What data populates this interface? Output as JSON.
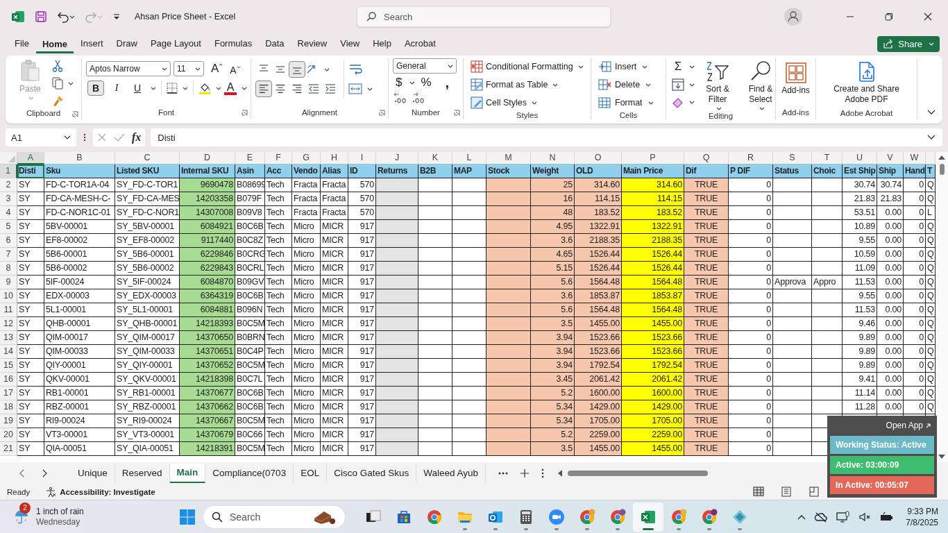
{
  "title_bar": {
    "title": "Ahsan Price Sheet  -  Excel",
    "search": {
      "placeholder": "Search"
    }
  },
  "menu": [
    {
      "label": "File",
      "selected": false
    },
    {
      "label": "Home",
      "selected": true
    },
    {
      "label": "Insert",
      "selected": false
    },
    {
      "label": "Draw",
      "selected": false
    },
    {
      "label": "Page Layout",
      "selected": false
    },
    {
      "label": "Formulas",
      "selected": false
    },
    {
      "label": "Data",
      "selected": false
    },
    {
      "label": "Review",
      "selected": false
    },
    {
      "label": "View",
      "selected": false
    },
    {
      "label": "Help",
      "selected": false
    },
    {
      "label": "Acrobat",
      "selected": false
    }
  ],
  "share": {
    "label": "Share"
  },
  "ribbon": {
    "clipboard": {
      "label": "Clipboard",
      "paste": {
        "label": "Paste",
        "disabled": true
      }
    },
    "font": {
      "label": "Font",
      "font_name": "Aptos Narrow",
      "font_size": "11",
      "grow": "A",
      "shrink": "A",
      "styles": [
        {
          "label": "B",
          "on": true
        },
        {
          "label": "I",
          "on": false
        },
        {
          "label": "U",
          "on": false
        }
      ],
      "font_color": "A"
    },
    "alignment": {
      "label": "Alignment",
      "vertical": [
        {
          "on": false
        },
        {
          "on": false
        },
        {
          "on": true
        }
      ],
      "horizontal": [
        {
          "on": true
        },
        {
          "on": false
        },
        {
          "on": false
        }
      ]
    },
    "number": {
      "label": "Number",
      "format": "General",
      "currency": "$",
      "percent": "%",
      "comma": ","
    },
    "styles": {
      "label": "Styles",
      "items": [
        "Conditional Formatting",
        "Format as Table",
        "Cell Styles"
      ]
    },
    "cells": {
      "label": "Cells",
      "items": [
        "Insert",
        "Delete",
        "Format"
      ]
    },
    "editing": {
      "label": "Editing",
      "sum": "Σ",
      "sort": "Sort & Filter",
      "find": "Find & Select"
    },
    "addins": {
      "label": "Add-ins",
      "button": "Add-ins"
    },
    "acrobat": {
      "label": "Adobe Acrobat",
      "button": "Create and Share Adobe PDF"
    }
  },
  "formula_bar": {
    "name_box": "A1",
    "fx": "fx",
    "value": "Disti"
  },
  "sheet": {
    "column_letters": [
      {
        "letter": "A",
        "selected": true
      },
      {
        "letter": "B",
        "selected": false
      },
      {
        "letter": "C",
        "selected": false
      },
      {
        "letter": "D",
        "selected": false
      },
      {
        "letter": "E",
        "selected": false
      },
      {
        "letter": "F",
        "selected": false
      },
      {
        "letter": "G",
        "selected": false
      },
      {
        "letter": "H",
        "selected": false
      },
      {
        "letter": "I",
        "selected": false
      },
      {
        "letter": "J",
        "selected": false
      },
      {
        "letter": "K",
        "selected": false
      },
      {
        "letter": "L",
        "selected": false
      },
      {
        "letter": "M",
        "selected": false
      },
      {
        "letter": "N",
        "selected": false
      },
      {
        "letter": "O",
        "selected": false
      },
      {
        "letter": "P",
        "selected": false
      },
      {
        "letter": "Q",
        "selected": false
      },
      {
        "letter": "R",
        "selected": false
      },
      {
        "letter": "S",
        "selected": false
      },
      {
        "letter": "T",
        "selected": false
      },
      {
        "letter": "U",
        "selected": false
      },
      {
        "letter": "V",
        "selected": false
      },
      {
        "letter": "W",
        "selected": false
      }
    ],
    "columns": [
      {
        "header": "Disti",
        "kind": "text",
        "color": "#ffffff"
      },
      {
        "header": "Sku",
        "kind": "text",
        "color": "#ffffff"
      },
      {
        "header": "Listed SKU",
        "kind": "text",
        "color": "#ffffff"
      },
      {
        "header": "Internal SKU",
        "kind": "number",
        "color": "#a9dc93"
      },
      {
        "header": "Asin",
        "kind": "text",
        "color": "#ffffff"
      },
      {
        "header": "Acc",
        "kind": "text",
        "color": "#ffffff"
      },
      {
        "header": "Vendo",
        "kind": "text",
        "color": "#ffffff"
      },
      {
        "header": "Alias",
        "kind": "text",
        "color": "#ffffff"
      },
      {
        "header": "ID",
        "kind": "number",
        "color": "#ffffff"
      },
      {
        "header": "Returns",
        "kind": "text",
        "color": "#e4e4e4"
      },
      {
        "header": "B2B",
        "kind": "text",
        "color": "#ffffff"
      },
      {
        "header": "MAP",
        "kind": "text",
        "color": "#ffffff"
      },
      {
        "header": "Stock",
        "kind": "text",
        "color": "#f6c6ad"
      },
      {
        "header": "Weight",
        "kind": "number",
        "color": "#f6c6ad"
      },
      {
        "header": "OLD",
        "kind": "number",
        "color": "#f6c6ad"
      },
      {
        "header": "Main Price",
        "kind": "number",
        "color": "#ffff00"
      },
      {
        "header": "Dif",
        "kind": "bool",
        "color": "#f6c6ad"
      },
      {
        "header": "P DIF",
        "kind": "number",
        "color": "#ffffff"
      },
      {
        "header": "Status",
        "kind": "text",
        "color": "#ffffff"
      },
      {
        "header": "Choic",
        "kind": "text",
        "color": "#ffffff"
      },
      {
        "header": "Est Ship",
        "kind": "number",
        "color": "#ffffff"
      },
      {
        "header": "Ship",
        "kind": "number",
        "color": "#ffffff"
      },
      {
        "header": "Hand",
        "kind": "number",
        "color": "#ffffff"
      },
      {
        "header": "T",
        "kind": "text",
        "color": "#ffffff"
      }
    ],
    "header_row": {
      "number": "1",
      "selected": true,
      "color": "#8fd0ef"
    },
    "rows": [
      {
        "number": "2",
        "selected": false,
        "cells": [
          "SY",
          "FD-C-TOR1A-04",
          "SY_FD-C-TOR1",
          "9690478",
          "B08699",
          "Tech",
          "Fracta",
          "Fracta",
          "570",
          null,
          null,
          null,
          null,
          "25",
          "314.60",
          "314.60",
          "TRUE",
          "0",
          null,
          null,
          "30.74",
          "30.74",
          "0",
          "Q"
        ]
      },
      {
        "number": "3",
        "selected": false,
        "cells": [
          "SY",
          "FD-CA-MESH-C-",
          "SY_FD-CA-MES",
          "14203358",
          "B079F",
          "Tech",
          "Fracta",
          "Fracta",
          "570",
          null,
          null,
          null,
          null,
          "16",
          "114.15",
          "114.15",
          "TRUE",
          "0",
          null,
          null,
          "21.83",
          "21.83",
          "0",
          "Q"
        ]
      },
      {
        "number": "4",
        "selected": false,
        "cells": [
          "SY",
          "FD-C-NOR1C-01",
          "SY_FD-C-NOR1",
          "14307008",
          "B09V8",
          "Tech",
          "Fracta",
          "Fracta",
          "570",
          null,
          null,
          null,
          null,
          "48",
          "183.52",
          "183.52",
          "TRUE",
          "0",
          null,
          null,
          "53.51",
          "0.00",
          "0",
          "L"
        ]
      },
      {
        "number": "5",
        "selected": false,
        "cells": [
          "SY",
          "5BV-00001",
          "SY_5BV-00001",
          "6084921",
          "B0C6B",
          "Tech",
          "Micro",
          "MICR",
          "917",
          null,
          null,
          null,
          null,
          "4.95",
          "1322.91",
          "1322.91",
          "TRUE",
          "0",
          null,
          null,
          "10.89",
          "0.00",
          "0",
          "Q"
        ]
      },
      {
        "number": "6",
        "selected": false,
        "cells": [
          "SY",
          "EF8-00002",
          "SY_EF8-00002",
          "9117440",
          "B0C8Z",
          "Tech",
          "Micro",
          "MICR",
          "917",
          null,
          null,
          null,
          null,
          "3.6",
          "2188.35",
          "2188.35",
          "TRUE",
          "0",
          null,
          null,
          "9.55",
          "0.00",
          "0",
          "Q"
        ]
      },
      {
        "number": "7",
        "selected": false,
        "cells": [
          "SY",
          "5B6-00001",
          "SY_5B6-00001",
          "6229846",
          "B0CRG",
          "Tech",
          "Micro",
          "MICR",
          "917",
          null,
          null,
          null,
          null,
          "4.65",
          "1526.44",
          "1526.44",
          "TRUE",
          "0",
          null,
          null,
          "10.59",
          "0.00",
          "0",
          "Q"
        ]
      },
      {
        "number": "8",
        "selected": false,
        "cells": [
          "SY",
          "5B6-00002",
          "SY_5B6-00002",
          "6229843",
          "B0CRL",
          "Tech",
          "Micro",
          "MICR",
          "917",
          null,
          null,
          null,
          null,
          "5.15",
          "1526.44",
          "1526.44",
          "TRUE",
          "0",
          null,
          null,
          "11.09",
          "0.00",
          "0",
          "Q"
        ]
      },
      {
        "number": "9",
        "selected": false,
        "cells": [
          "SY",
          "5IF-00024",
          "SY_5IF-00024",
          "6084870",
          "B09GV",
          "Tech",
          "Micro",
          "MICR",
          "917",
          null,
          null,
          null,
          null,
          "5.6",
          "1564.48",
          "1564.48",
          "TRUE",
          "0",
          "Approva",
          "Appro",
          "11.53",
          "0.00",
          "0",
          "Q"
        ]
      },
      {
        "number": "10",
        "selected": false,
        "cells": [
          "SY",
          "EDX-00003",
          "SY_EDX-00003",
          "6364319",
          "B0C6B",
          "Tech",
          "Micro",
          "MICR",
          "917",
          null,
          null,
          null,
          null,
          "3.6",
          "1853.87",
          "1853.87",
          "TRUE",
          "0",
          null,
          null,
          "9.55",
          "0.00",
          "0",
          "Q"
        ]
      },
      {
        "number": "11",
        "selected": false,
        "cells": [
          "SY",
          "5L1-00001",
          "SY_5L1-00001",
          "6084881",
          "B096N",
          "Tech",
          "Micro",
          "MICR",
          "917",
          null,
          null,
          null,
          null,
          "5.6",
          "1564.48",
          "1564.48",
          "TRUE",
          "0",
          null,
          null,
          "11.53",
          "0.00",
          "0",
          "Q"
        ]
      },
      {
        "number": "12",
        "selected": false,
        "cells": [
          "SY",
          "QHB-00001",
          "SY_QHB-00001",
          "14218393",
          "B0C5M",
          "Tech",
          "Micro",
          "MICR",
          "917",
          null,
          null,
          null,
          null,
          "3.5",
          "1455.00",
          "1455.00",
          "TRUE",
          "0",
          null,
          null,
          "9.46",
          "0.00",
          "0",
          "Q"
        ]
      },
      {
        "number": "13",
        "selected": false,
        "cells": [
          "SY",
          "QIM-00017",
          "SY_QIM-00017",
          "14370650",
          "B0BRN",
          "Tech",
          "Micro",
          "MICR",
          "917",
          null,
          null,
          null,
          null,
          "3.94",
          "1523.66",
          "1523.66",
          "TRUE",
          "0",
          null,
          null,
          "9.89",
          "0.00",
          "0",
          "Q"
        ]
      },
      {
        "number": "14",
        "selected": false,
        "cells": [
          "SY",
          "QIM-00033",
          "SY_QIM-00033",
          "14370651",
          "B0C4P",
          "Tech",
          "Micro",
          "MICR",
          "917",
          null,
          null,
          null,
          null,
          "3.94",
          "1523.66",
          "1523.66",
          "TRUE",
          "0",
          null,
          null,
          "9.89",
          "0.00",
          "0",
          "Q"
        ]
      },
      {
        "number": "15",
        "selected": false,
        "cells": [
          "SY",
          "QIY-00001",
          "SY_QIY-00001",
          "14370652",
          "B0C5M",
          "Tech",
          "Micro",
          "MICR",
          "917",
          null,
          null,
          null,
          null,
          "3.94",
          "1792.54",
          "1792.54",
          "TRUE",
          "0",
          null,
          null,
          "9.89",
          "0.00",
          "0",
          "Q"
        ]
      },
      {
        "number": "16",
        "selected": false,
        "cells": [
          "SY",
          "QKV-00001",
          "SY_QKV-00001",
          "14218398",
          "B0C7L",
          "Tech",
          "Micro",
          "MICR",
          "917",
          null,
          null,
          null,
          null,
          "3.45",
          "2061.42",
          "2061.42",
          "TRUE",
          "0",
          null,
          null,
          "9.41",
          "0.00",
          "0",
          "Q"
        ]
      },
      {
        "number": "17",
        "selected": false,
        "cells": [
          "SY",
          "RB1-00001",
          "SY_RB1-00001",
          "14370677",
          "B0C6B",
          "Tech",
          "Micro",
          "MICR",
          "917",
          null,
          null,
          null,
          null,
          "5.2",
          "1600.00",
          "1600.00",
          "TRUE",
          "0",
          null,
          null,
          "11.14",
          "0.00",
          "0",
          "Q"
        ]
      },
      {
        "number": "18",
        "selected": false,
        "cells": [
          "SY",
          "RBZ-00001",
          "SY_RBZ-00001",
          "14370662",
          "B0C6B",
          "Tech",
          "Micro",
          "MICR",
          "917",
          null,
          null,
          null,
          null,
          "5.34",
          "1429.00",
          "1429.00",
          "TRUE",
          "0",
          null,
          null,
          "11.28",
          "0.00",
          "0",
          "Q"
        ]
      },
      {
        "number": "19",
        "selected": false,
        "cells": [
          "SY",
          "RI9-00024",
          "SY_RI9-00024",
          "14370667",
          "B0C5M",
          "Tech",
          "Micro",
          "MICR",
          "917",
          null,
          null,
          null,
          null,
          "5.34",
          "1705.00",
          "1705.00",
          "TRUE",
          "0",
          null,
          null,
          null,
          null,
          null,
          null
        ]
      },
      {
        "number": "20",
        "selected": false,
        "cells": [
          "SY",
          "VT3-00001",
          "SY_VT3-00001",
          "14370679",
          "B0C66",
          "Tech",
          "Micro",
          "MICR",
          "917",
          null,
          null,
          null,
          null,
          "5.2",
          "2259.00",
          "2259.00",
          "TRUE",
          "0",
          null,
          null,
          null,
          null,
          null,
          null
        ]
      },
      {
        "number": "21",
        "selected": false,
        "cells": [
          "SY",
          "QIA-00051",
          "SY_QIA-00051",
          "14218391",
          "B0C5M",
          "Tech",
          "Micro",
          "MICR",
          "917",
          null,
          null,
          null,
          null,
          "3.5",
          "1455.00",
          "1455.00",
          "TRUE",
          "0",
          null,
          null,
          null,
          null,
          null,
          null
        ]
      }
    ]
  },
  "sheet_tabs": [
    {
      "label": "Unique",
      "selected": false
    },
    {
      "label": "Reserved",
      "selected": false
    },
    {
      "label": "Main",
      "selected": true
    },
    {
      "label": "Compliance(0703",
      "selected": false
    },
    {
      "label": "EOL",
      "selected": false
    },
    {
      "label": "Cisco Gated Skus",
      "selected": false
    },
    {
      "label": "Waleed Ayub",
      "selected": false
    }
  ],
  "status_bar": {
    "mode": "Ready",
    "accessibility": "Accessibility: Investigate",
    "views": [
      {
        "selected": true
      },
      {
        "selected": false
      },
      {
        "selected": false
      }
    ]
  },
  "tracker": {
    "open_app": "Open App",
    "statuses": [
      {
        "label": "Working Status: Active",
        "color": "#6cbac8"
      },
      {
        "label": "Active: 03:00:09",
        "color": "#3ebd6e"
      },
      {
        "label": "In Active: 00:05:07",
        "color": "#e4685a"
      }
    ]
  },
  "taskbar": {
    "weather": {
      "badge": "2",
      "title": "1 inch of rain",
      "subtitle": "Wednesday"
    },
    "search": {
      "placeholder": "Search"
    },
    "apps": [
      {
        "running": false,
        "selected": false
      },
      {
        "running": false,
        "selected": false
      },
      {
        "running": false,
        "selected": false
      },
      {
        "running": true,
        "selected": false
      },
      {
        "running": true,
        "selected": false
      },
      {
        "running": true,
        "selected": false
      },
      {
        "running": true,
        "selected": false
      },
      {
        "running": true,
        "selected": false
      },
      {
        "running": true,
        "selected": false
      },
      {
        "running": true,
        "selected": true
      },
      {
        "running": true,
        "selected": false
      },
      {
        "running": true,
        "selected": false
      },
      {
        "running": true,
        "selected": false
      }
    ],
    "clock": {
      "time": "9:33 PM",
      "date": "7/8/2025"
    }
  }
}
